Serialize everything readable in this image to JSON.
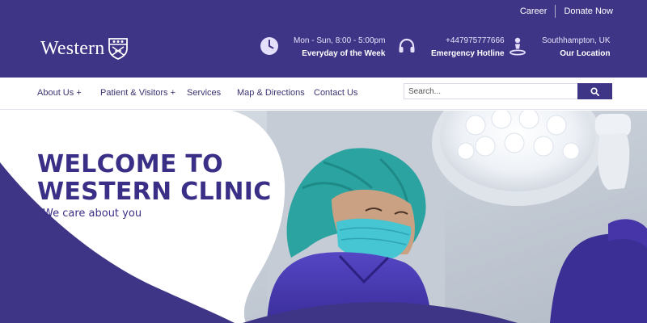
{
  "topbar": {
    "career": "Career",
    "donate": "Donate Now"
  },
  "brand": {
    "name": "Western"
  },
  "info": [
    {
      "icon": "clock-icon",
      "line1": "Mon - Sun, 8:00 - 5:00pm",
      "line2": "Everyday of the Week"
    },
    {
      "icon": "headset-icon",
      "line1": "+447975777666",
      "line2": "Emergency Hotline"
    },
    {
      "icon": "location-icon",
      "line1": "Southhampton, UK",
      "line2": "Our Location"
    }
  ],
  "nav": [
    {
      "label": "About Us +"
    },
    {
      "label": "Patient & Visitors +"
    },
    {
      "label": "Services"
    },
    {
      "label": "Map & Directions"
    },
    {
      "label": "Contact Us"
    }
  ],
  "search": {
    "placeholder": "Search...",
    "value": ""
  },
  "hero": {
    "title_line1": "WELCOME TO",
    "title_line2": "WESTERN CLINIC",
    "subtitle": "We care about you"
  },
  "colors": {
    "primary": "#3f3586",
    "heading": "#3a2f86",
    "scrubs": "#4636b0",
    "cap": "#2ba3a0"
  }
}
